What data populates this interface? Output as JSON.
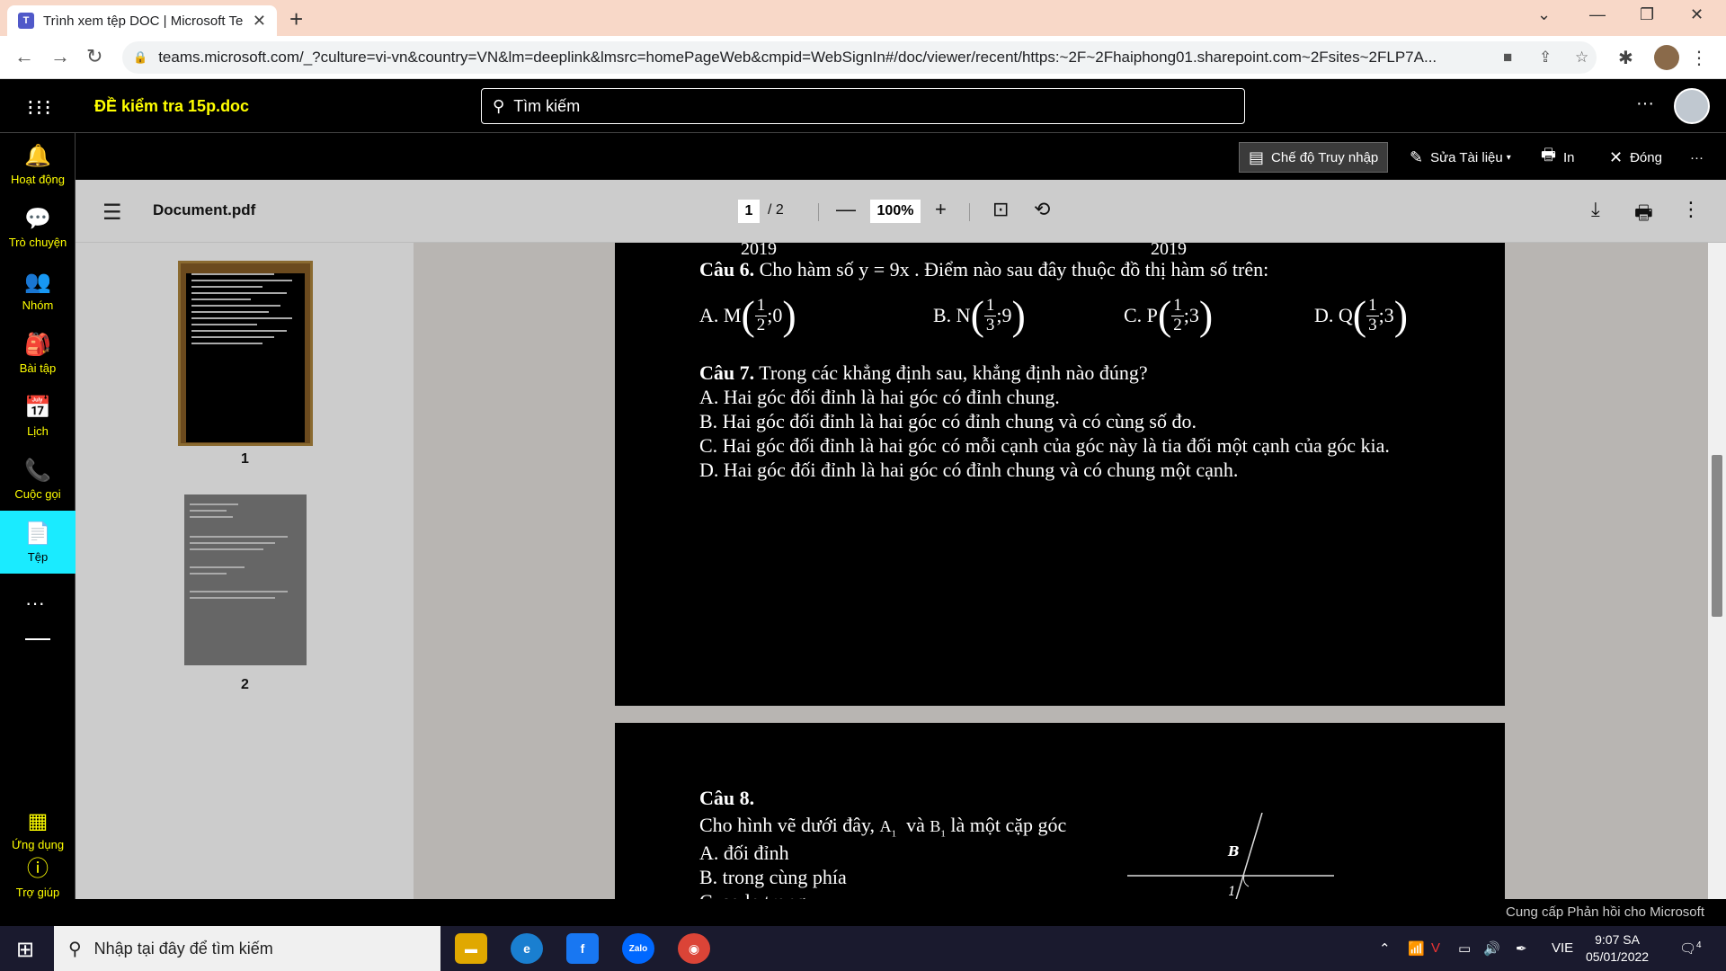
{
  "browser": {
    "tab_title": "Trình xem tệp DOC | Microsoft Te",
    "url": "teams.microsoft.com/_?culture=vi-vn&country=VN&lm=deeplink&lmsrc=homePageWeb&cmpid=WebSignIn#/doc/viewer/recent/https:~2F~2Fhaiphong01.sharepoint.com~2Fsites~2FLP7A..."
  },
  "header": {
    "doc_title": "ĐỀ kiểm tra 15p.doc",
    "search_placeholder": "Tìm kiếm"
  },
  "rail": {
    "items": [
      {
        "label": "Hoạt động",
        "icon": "bell-icon"
      },
      {
        "label": "Trò chuyện",
        "icon": "chat-icon"
      },
      {
        "label": "Nhóm",
        "icon": "teams-icon"
      },
      {
        "label": "Bài tập",
        "icon": "backpack-icon"
      },
      {
        "label": "Lịch",
        "icon": "calendar-icon"
      },
      {
        "label": "Cuộc gọi",
        "icon": "phone-icon"
      },
      {
        "label": "Tệp",
        "icon": "file-icon"
      },
      {
        "label": "Ứng dụng",
        "icon": "apps-icon"
      },
      {
        "label": "Trợ giúp",
        "icon": "help-icon"
      }
    ],
    "active": "Tệp"
  },
  "commands": {
    "access_mode": "Chế độ Truy nhập",
    "edit": "Sửa Tài liệu",
    "print": "In",
    "close": "Đóng"
  },
  "pdf": {
    "filename": "Document.pdf",
    "current_page": "1",
    "total_pages": "2",
    "zoom": "100%",
    "thumbnails": [
      "1",
      "2"
    ]
  },
  "page1": {
    "year_left": "2019",
    "year_right": "2019",
    "q6_label": "Câu 6.",
    "q6_text": "Cho hàm số y = 9x . Điểm nào sau đây thuộc đồ thị hàm số trên:",
    "q6_options": [
      {
        "prefix": "A. M",
        "num": "1",
        "den": "2",
        "rest": ";0"
      },
      {
        "prefix": "B. N",
        "num": "1",
        "den": "3",
        "rest": ";9"
      },
      {
        "prefix": "C. P",
        "num": "1",
        "den": "2",
        "rest": ";3"
      },
      {
        "prefix": "D. Q",
        "num": "1",
        "den": "3",
        "rest": ";3"
      }
    ],
    "q7_label": "Câu 7.",
    "q7_text": "Trong các khẳng định sau, khẳng định nào đúng?",
    "q7_options": [
      "A. Hai góc đối đỉnh là hai góc có đỉnh chung.",
      "B. Hai góc đối đỉnh là hai góc có đỉnh chung và có cùng số đo.",
      "C. Hai góc đối đỉnh là hai góc có mỗi cạnh của góc này là tia đối một cạnh của góc kia.",
      "D. Hai góc đối đỉnh là hai góc có đỉnh chung và có chung một cạnh."
    ]
  },
  "page2": {
    "q8_label": "Câu 8.",
    "q8_text_a": "Cho hình vẽ dưới đây,",
    "q8_a1": "A",
    "q8_sub": "1",
    "q8_and": "và",
    "q8_b1": "B",
    "q8_text_b": "là một cặp góc",
    "q8_options": [
      "A. đối đỉnh",
      "B. trong cùng phía",
      "C. so le trong"
    ],
    "figure_label_b": "B",
    "figure_label_1": "1"
  },
  "feedback": "Cung cấp Phản hồi cho Microsoft",
  "taskbar": {
    "search_placeholder": "Nhập tại đây để tìm kiếm",
    "lang": "VIE",
    "time": "9:07 SA",
    "date": "05/01/2022",
    "notifications": "4",
    "zalo": "Zalo"
  }
}
